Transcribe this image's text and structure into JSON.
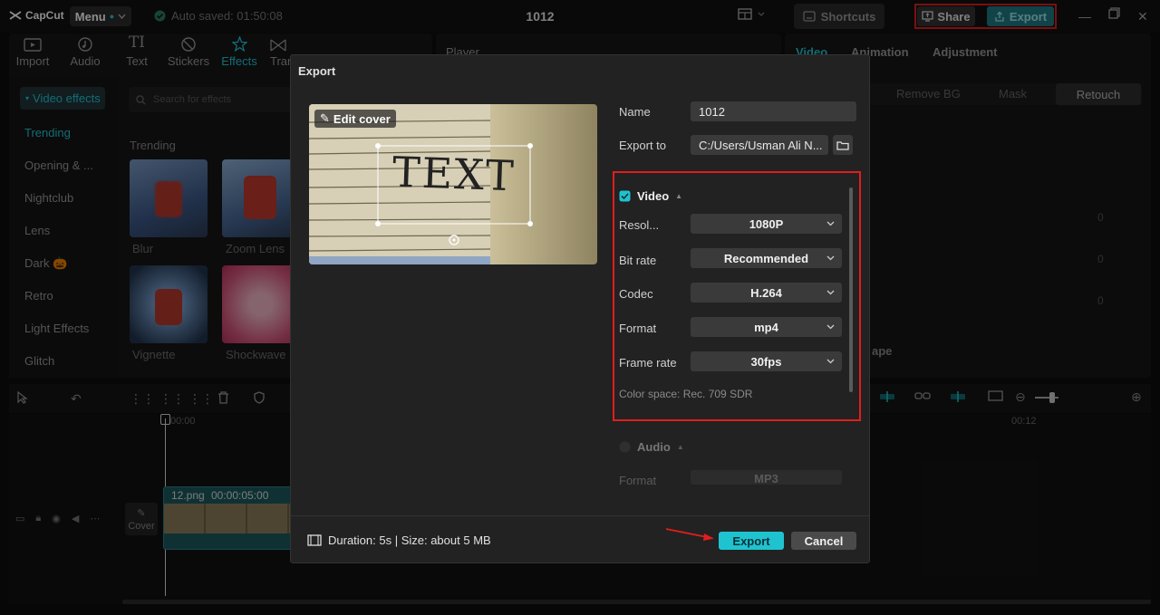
{
  "app": {
    "logo_text": "CapCut",
    "menu_label": "Menu",
    "autosave_text": "Auto saved: 01:50:08",
    "project_title": "1012",
    "shortcuts_label": "Shortcuts",
    "share_label": "Share",
    "export_label": "Export"
  },
  "toolbar": {
    "items": [
      {
        "label": "Import"
      },
      {
        "label": "Audio"
      },
      {
        "label": "Text"
      },
      {
        "label": "Stickers"
      },
      {
        "label": "Effects"
      },
      {
        "label": "Tran"
      }
    ]
  },
  "effects": {
    "active_category": "Video effects",
    "search_placeholder": "Search for effects",
    "categories": [
      "Trending",
      "Opening & ...",
      "Nightclub",
      "Lens",
      "Dark 🎃",
      "Retro",
      "Light Effects",
      "Glitch"
    ],
    "section_title": "Trending",
    "thumbs": [
      "Blur",
      "Zoom Lens",
      "Vignette",
      "Shockwave"
    ]
  },
  "player": {
    "title": "Player"
  },
  "right_panel": {
    "tabs": [
      "Video",
      "Animation",
      "Adjustment"
    ],
    "subtabs": [
      "Remove BG",
      "Mask",
      "Retouch"
    ],
    "partial_label": "ape",
    "values": [
      "0",
      "0",
      "0"
    ]
  },
  "timeline": {
    "time_start": "00:00",
    "time_end": "00:12",
    "clip_name": "12.png",
    "clip_duration": "00:00:05:00",
    "cover_label": "Cover"
  },
  "dialog": {
    "title": "Export",
    "edit_cover_label": "Edit cover",
    "cover_text": "TEXT",
    "name_label": "Name",
    "name_value": "1012",
    "export_to_label": "Export to",
    "export_to_value": "C:/Users/Usman Ali N...",
    "video_section": "Video",
    "resolution_label": "Resol...",
    "resolution_value": "1080P",
    "bitrate_label": "Bit rate",
    "bitrate_value": "Recommended",
    "codec_label": "Codec",
    "codec_value": "H.264",
    "format_label": "Format",
    "format_value": "mp4",
    "framerate_label": "Frame rate",
    "framerate_value": "30fps",
    "color_space": "Color space: Rec. 709 SDR",
    "audio_section": "Audio",
    "audio_format_label": "Format",
    "audio_format_value": "MP3",
    "duration_size": "Duration: 5s | Size: about 5 MB",
    "export_button": "Export",
    "cancel_button": "Cancel"
  },
  "colors": {
    "accent": "#1fc3cf",
    "highlight_red": "#e01e1e",
    "dialog_bg": "#222222"
  }
}
